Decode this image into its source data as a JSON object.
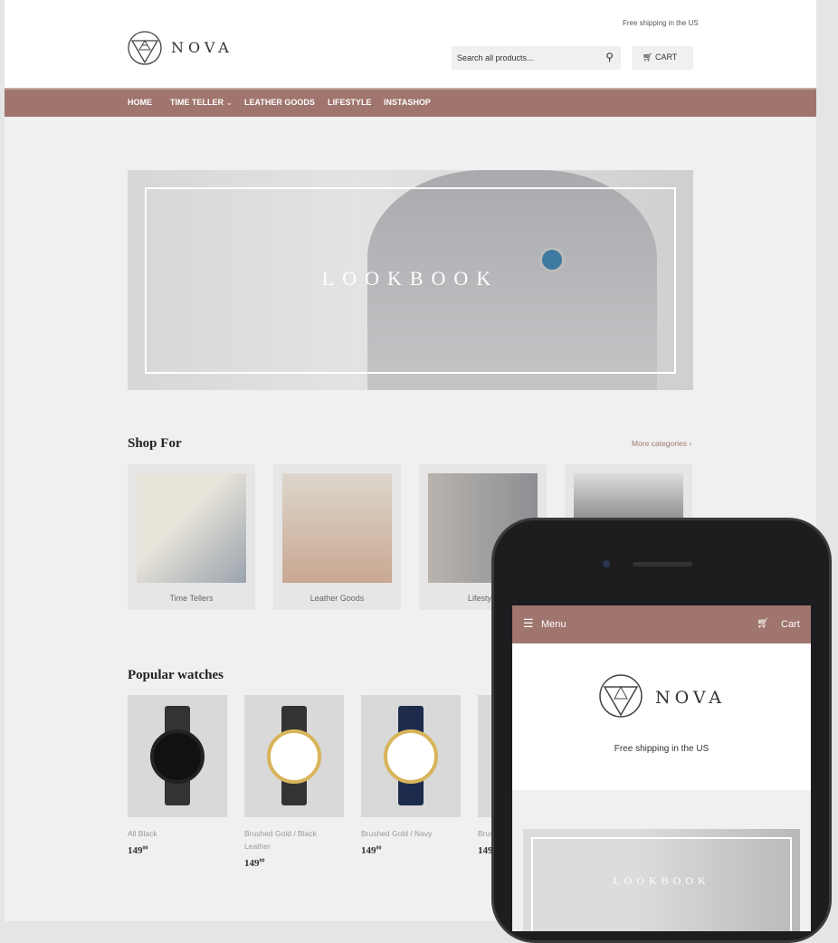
{
  "header": {
    "shipping": "Free shipping in the US",
    "brand": "NOVA",
    "search_placeholder": "Search all products...",
    "cart_label": "CART"
  },
  "nav": [
    "HOME",
    "TIME TELLER",
    "LEATHER GOODS",
    "LIFESTYLE",
    "INSTASHOP"
  ],
  "hero": {
    "title": "LOOKBOOK"
  },
  "shop_for": {
    "title": "Shop For",
    "more": "More categories ›",
    "categories": [
      "Time Tellers",
      "Leather Goods",
      "Lifestyle",
      ""
    ]
  },
  "popular": {
    "title": "Popular watches",
    "products": [
      {
        "name": "All Black",
        "price": "149",
        "cents": "00",
        "dial": "#111",
        "case": "#222",
        "strap": "#333"
      },
      {
        "name": "Brushed Gold / Black Leather",
        "price": "149",
        "cents": "00",
        "dial": "#fff",
        "case": "#d8b45a",
        "strap": "#333"
      },
      {
        "name": "Brushed Gold / Navy",
        "price": "149",
        "cents": "00",
        "dial": "#fff",
        "case": "#d8b45a",
        "strap": "#1d2b4d"
      },
      {
        "name": "Brus",
        "price": "149",
        "cents": "",
        "dial": "#fff",
        "case": "#ccc",
        "strap": "#555"
      }
    ]
  },
  "mobile": {
    "menu": "Menu",
    "cart": "Cart",
    "brand": "NOVA",
    "shipping": "Free shipping in the US",
    "hero_title": "LOOKBOOK"
  },
  "colors": {
    "accent": "#a0756e"
  }
}
